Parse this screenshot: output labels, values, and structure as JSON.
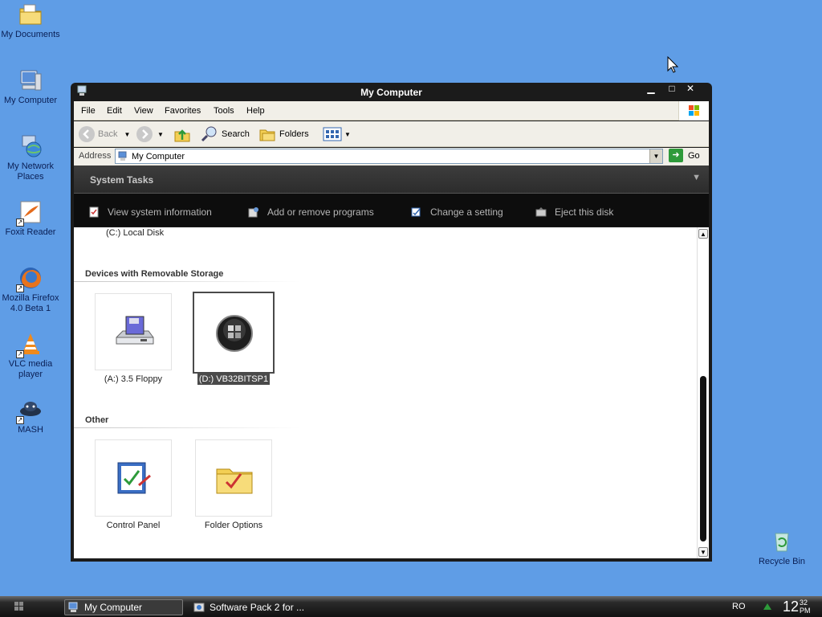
{
  "desktop": {
    "icons": [
      {
        "label": "My Documents"
      },
      {
        "label": "My Computer"
      },
      {
        "label": "My Network Places"
      },
      {
        "label": "Foxit Reader"
      },
      {
        "label": "Mozilla Firefox 4.0 Beta 1"
      },
      {
        "label": "VLC media player"
      },
      {
        "label": "MASH"
      },
      {
        "label": "Recycle Bin"
      }
    ]
  },
  "window": {
    "title": "My Computer",
    "controls": {
      "minimize": "▁",
      "maximize": "□",
      "close": "✕"
    },
    "menu": [
      "File",
      "Edit",
      "View",
      "Favorites",
      "Tools",
      "Help"
    ],
    "toolbar": {
      "back": "Back",
      "search": "Search",
      "folders": "Folders"
    },
    "address": {
      "label": "Address",
      "value": "My Computer",
      "go": "Go"
    },
    "tasks": {
      "header": "System Tasks",
      "items": [
        "View system information",
        "Add or remove programs",
        "Change a setting",
        "Eject this disk"
      ]
    },
    "content": {
      "top_item": "(C:) Local Disk",
      "groups": [
        {
          "title": "Devices with Removable Storage",
          "items": [
            "(A:) 3.5 Floppy",
            "(D:) VB32BITSP1"
          ]
        },
        {
          "title": "Other",
          "items": [
            "Control Panel",
            "Folder Options"
          ]
        }
      ]
    }
  },
  "taskbar": {
    "buttons": [
      "My Computer",
      "Software Pack 2 for ..."
    ],
    "language": "RO",
    "clock_hour": "12",
    "clock_min": "32",
    "clock_ampm": "PM"
  }
}
